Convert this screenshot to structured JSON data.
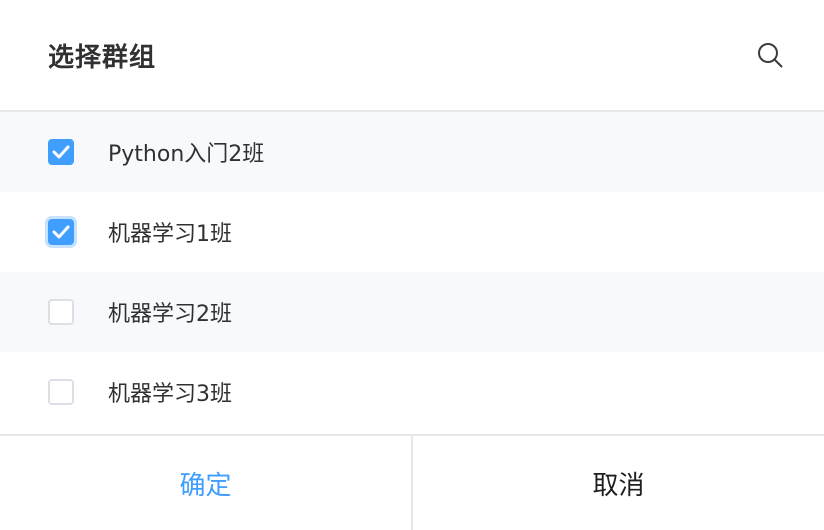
{
  "dialog": {
    "title": "选择群组",
    "search_icon": "search-icon"
  },
  "groups": [
    {
      "label": "Python入门2班",
      "checked": true
    },
    {
      "label": "机器学习1班",
      "checked": true,
      "focused": true
    },
    {
      "label": "机器学习2班",
      "checked": false
    },
    {
      "label": "机器学习3班",
      "checked": false
    }
  ],
  "footer": {
    "confirm_label": "确定",
    "cancel_label": "取消"
  },
  "colors": {
    "accent": "#409eff",
    "row_alt": "#f8f9fc",
    "divider": "#e7e8eb"
  }
}
